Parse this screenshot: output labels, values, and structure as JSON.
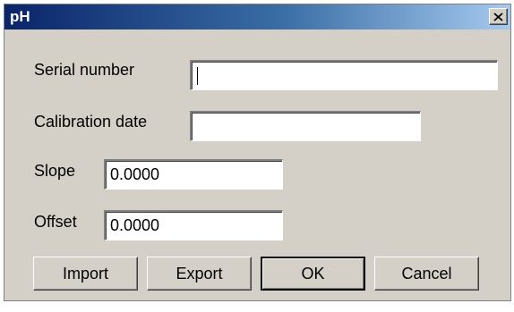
{
  "window": {
    "title": "pH",
    "close_symbol": "X"
  },
  "form": {
    "serial_number": {
      "label": "Serial number",
      "value": ""
    },
    "calibration_date": {
      "label": "Calibration date",
      "value": ""
    },
    "slope": {
      "label": "Slope",
      "value": "0.0000"
    },
    "offset": {
      "label": "Offset",
      "value": "0.0000"
    }
  },
  "buttons": {
    "import": "Import",
    "export": "Export",
    "ok": "OK",
    "cancel": "Cancel"
  },
  "colors": {
    "title_gradient_start": "#0a246a",
    "title_gradient_end": "#a6caf0",
    "dialog_face": "#d4d0c8"
  }
}
